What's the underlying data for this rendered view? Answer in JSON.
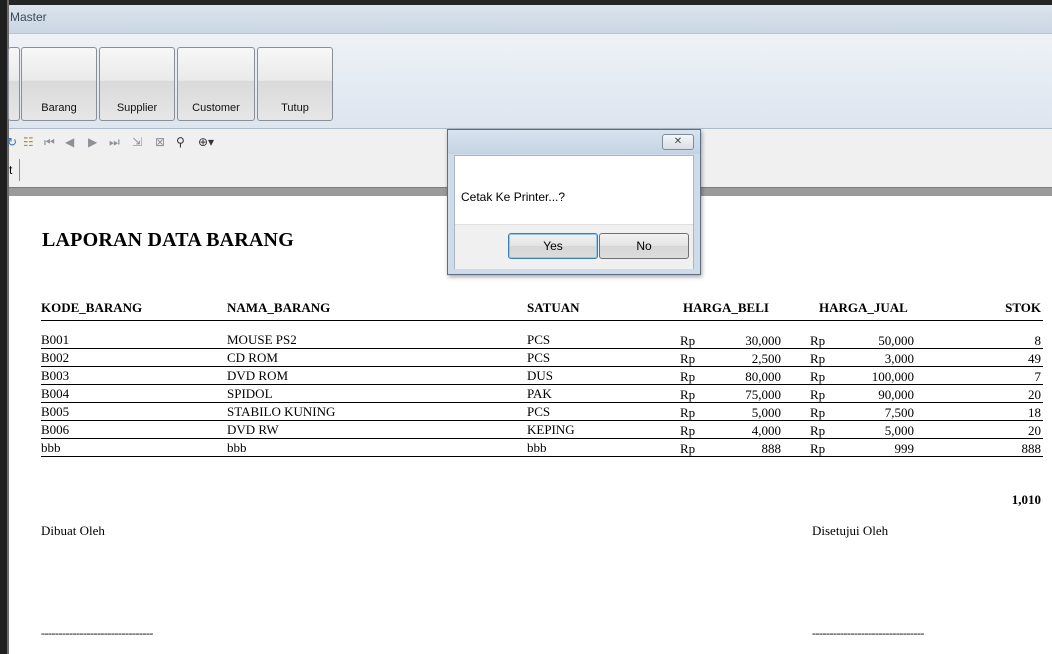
{
  "window": {
    "title": "Master"
  },
  "ribbon": {
    "buttons": [
      {
        "label": "Barang"
      },
      {
        "label": "Supplier"
      },
      {
        "label": "Customer"
      },
      {
        "label": "Tutup"
      }
    ]
  },
  "viewer_toolbar": {
    "field_text": "t",
    "icons": [
      "refresh-icon",
      "group-tree-icon",
      "first-page-icon",
      "prev-page-icon",
      "next-page-icon",
      "last-page-icon",
      "goto-page-icon",
      "stop-icon",
      "find-icon",
      "zoom-icon"
    ]
  },
  "report": {
    "title": "LAPORAN DATA BARANG",
    "columns": [
      "KODE_BARANG",
      "NAMA_BARANG",
      "SATUAN",
      "HARGA_BELI",
      "HARGA_JUAL",
      "STOK"
    ],
    "currency": "Rp",
    "rows": [
      {
        "kode": "B001",
        "nama": "MOUSE PS2",
        "satuan": "PCS",
        "beli": "30,000",
        "jual": "50,000",
        "stok": "8"
      },
      {
        "kode": "B002",
        "nama": "CD ROM",
        "satuan": "PCS",
        "beli": "2,500",
        "jual": "3,000",
        "stok": "49"
      },
      {
        "kode": "B003",
        "nama": "DVD ROM",
        "satuan": "DUS",
        "beli": "80,000",
        "jual": "100,000",
        "stok": "7"
      },
      {
        "kode": "B004",
        "nama": "SPIDOL",
        "satuan": "PAK",
        "beli": "75,000",
        "jual": "90,000",
        "stok": "20"
      },
      {
        "kode": "B005",
        "nama": "STABILO KUNING",
        "satuan": "PCS",
        "beli": "5,000",
        "jual": "7,500",
        "stok": "18"
      },
      {
        "kode": "B006",
        "nama": "DVD RW",
        "satuan": "KEPING",
        "beli": "4,000",
        "jual": "5,000",
        "stok": "20"
      },
      {
        "kode": "bbb",
        "nama": "bbb",
        "satuan": "bbb",
        "beli": "888",
        "jual": "999",
        "stok": "888"
      }
    ],
    "total_stok": "1,010",
    "made_by": "Dibuat Oleh",
    "approved_by": "Disetujui Oleh",
    "signature_line": "--------------------------------"
  },
  "dialog": {
    "message": "Cetak Ke Printer...?",
    "yes_label": "Yes",
    "no_label": "No",
    "close_glyph": "✕"
  }
}
